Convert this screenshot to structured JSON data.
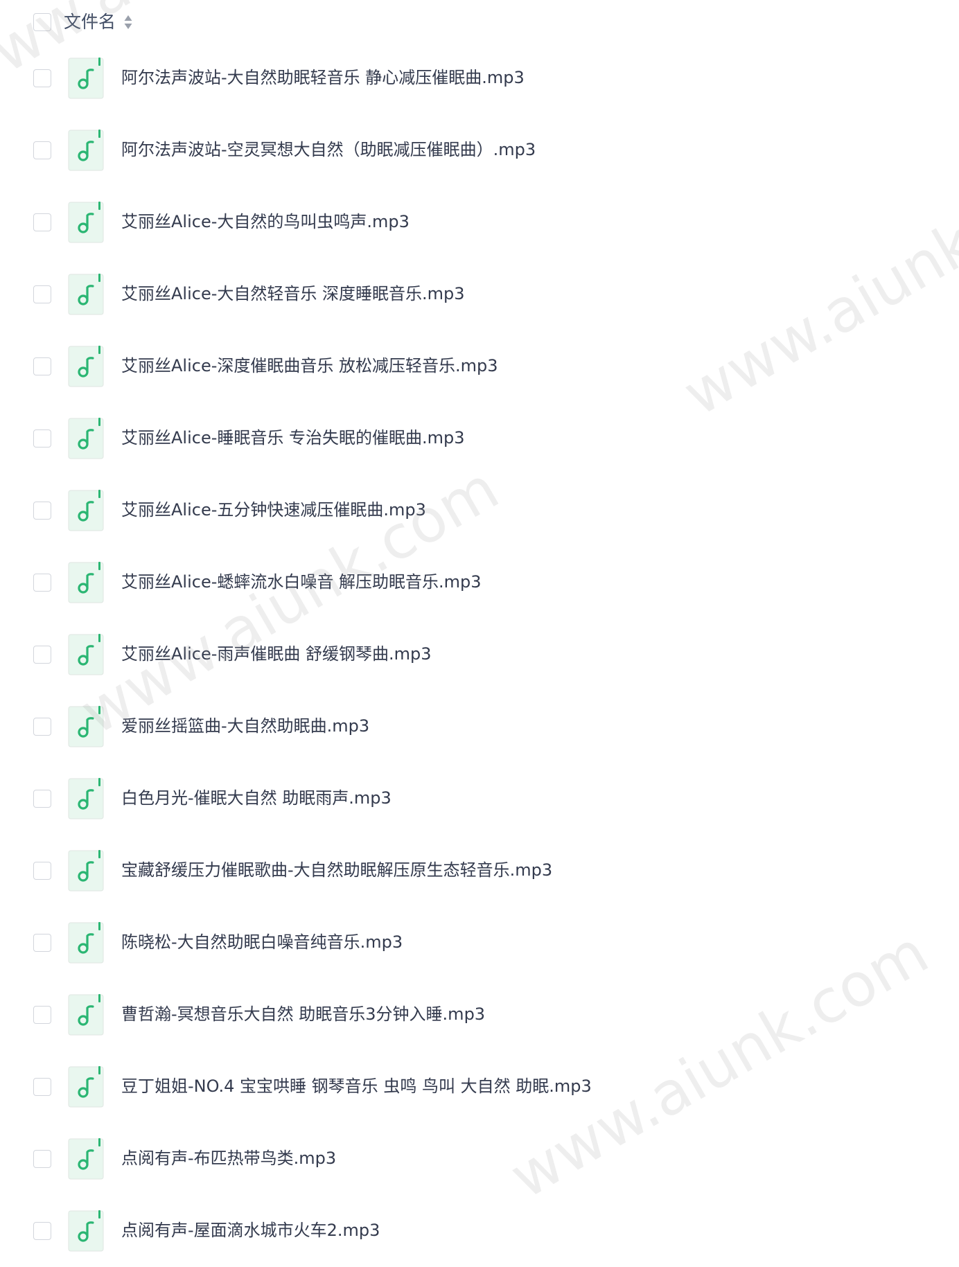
{
  "header": {
    "label": "文件名",
    "sort_icon": "sort-icon"
  },
  "file_icon": "music-file-icon",
  "colors": {
    "accent": "#2bb673",
    "icon_bg": "#e9f7ef",
    "checkbox_border": "#d2d5dc",
    "text": "#333a4d",
    "watermark": "#969696"
  },
  "files": [
    {
      "name": "阿尔法声波站-大自然助眠轻音乐 静心减压催眠曲.mp3"
    },
    {
      "name": "阿尔法声波站-空灵冥想大自然（助眠减压催眠曲）.mp3"
    },
    {
      "name": "艾丽丝Alice-大自然的鸟叫虫鸣声.mp3"
    },
    {
      "name": "艾丽丝Alice-大自然轻音乐 深度睡眠音乐.mp3"
    },
    {
      "name": "艾丽丝Alice-深度催眠曲音乐 放松减压轻音乐.mp3"
    },
    {
      "name": "艾丽丝Alice-睡眠音乐 专治失眠的催眠曲.mp3"
    },
    {
      "name": "艾丽丝Alice-五分钟快速减压催眠曲.mp3"
    },
    {
      "name": "艾丽丝Alice-蟋蟀流水白噪音 解压助眠音乐.mp3"
    },
    {
      "name": "艾丽丝Alice-雨声催眠曲 舒缓钢琴曲.mp3"
    },
    {
      "name": "爱丽丝摇篮曲-大自然助眠曲.mp3"
    },
    {
      "name": "白色月光-催眠大自然 助眠雨声.mp3"
    },
    {
      "name": "宝藏舒缓压力催眠歌曲-大自然助眠解压原生态轻音乐.mp3"
    },
    {
      "name": "陈晓松-大自然助眠白噪音纯音乐.mp3"
    },
    {
      "name": "曹哲瀚-冥想音乐大自然 助眠音乐3分钟入睡.mp3"
    },
    {
      "name": "豆丁姐姐-NO.4 宝宝哄睡 钢琴音乐 虫鸣 鸟叫 大自然 助眠.mp3"
    },
    {
      "name": "点阅有声-布匹热带鸟类.mp3"
    },
    {
      "name": "点阅有声-屋面滴水城市火车2.mp3"
    }
  ],
  "watermarks": [
    {
      "text": "www.aiunk.com"
    },
    {
      "text": "www.aiunk.com"
    },
    {
      "text": "www.aiunk.com"
    },
    {
      "text": "www.aiunk.com"
    }
  ]
}
